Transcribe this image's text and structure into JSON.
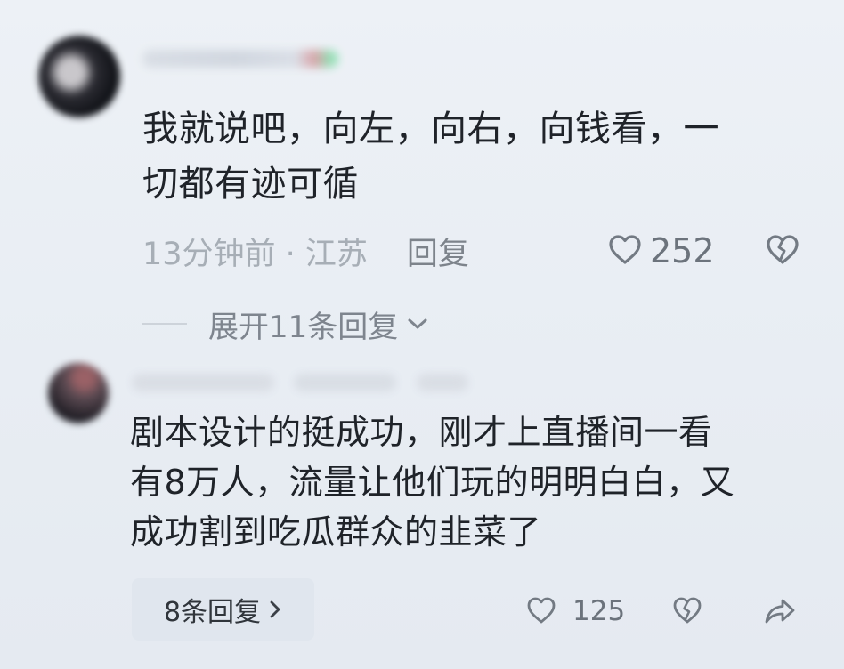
{
  "first_comment": {
    "text": "我就说吧，向左，向右，向钱看，一\n切都有迹可循",
    "meta": "13分钟前 · 江苏",
    "reply_label": "回复",
    "like_count": "252",
    "expand_replies_label": "展开11条回复"
  },
  "second_comment": {
    "text": "剧本设计的挺成功，刚才上直播间一看\n有8万人，流量让他们玩的明明白白，又\n成功割到吃瓜群众的韭菜了",
    "reply_count_label": "8条回复",
    "like_count": "125"
  },
  "icons": {
    "like": "heart-outline-icon",
    "dislike": "broken-heart-icon",
    "share": "share-arrow-icon",
    "chevron_down": "chevron-down-icon",
    "chevron_right": "chevron-right-icon"
  }
}
